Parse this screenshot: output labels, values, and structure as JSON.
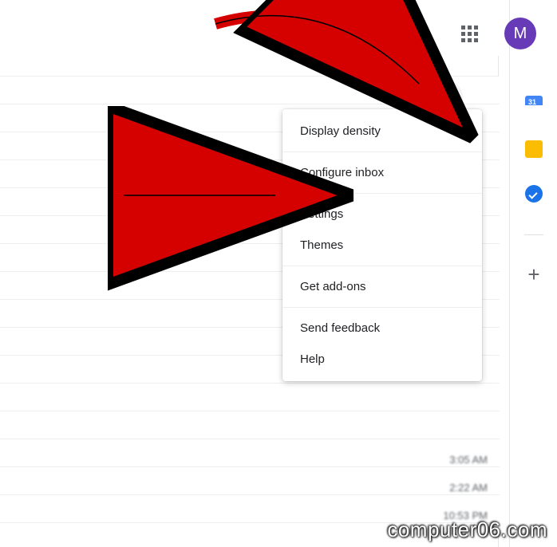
{
  "header": {
    "avatar_initial": "M"
  },
  "sidebar": {
    "calendar_date": "31",
    "plus_symbol": "+"
  },
  "menu": {
    "items": [
      "Display density",
      "Configure inbox",
      "Settings",
      "Themes",
      "Get add-ons",
      "Send feedback",
      "Help"
    ]
  },
  "rows": {
    "times": [
      "3:05 AM",
      "2:22 AM",
      "10:53 PM"
    ]
  },
  "watermark": "computer06.com"
}
